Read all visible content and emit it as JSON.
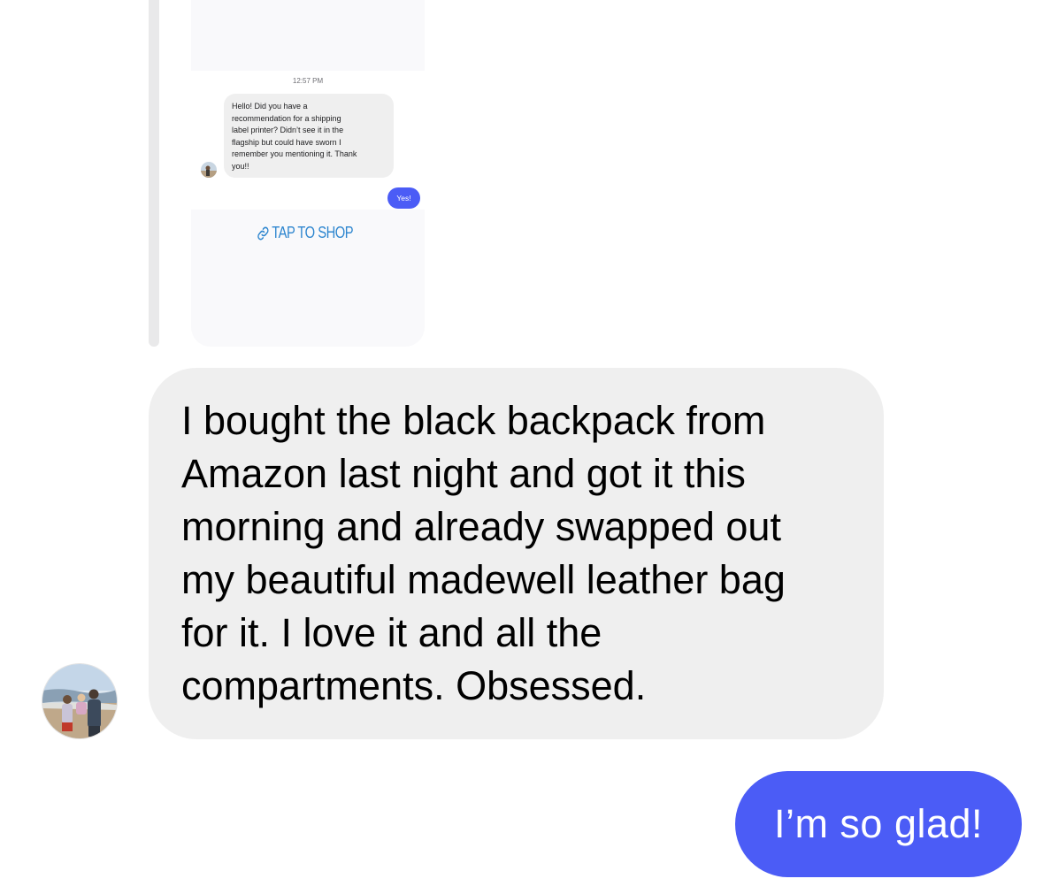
{
  "quoted_thread": {
    "timestamp": "12:57 PM",
    "received_message_lines": [
      "Hello! Did you have a",
      "recommendation for a shipping",
      "label printer? Didn’t see it in the",
      "flagship but could have sworn I",
      "remember you mentioning it. Thank",
      "you!!"
    ],
    "sent_message": "Yes!",
    "link_label": "TAP TO SHOP",
    "link_icon": "link-icon"
  },
  "conversation": {
    "received_message_lines": [
      "I bought the black backpack from",
      "Amazon last night and got it this",
      "morning and already swapped out",
      "my beautiful madewell leather bag",
      "for it. I love it and all the",
      "compartments. Obsessed."
    ],
    "sent_message": "I’m so glad!"
  },
  "colors": {
    "sent_bubble": "#4b5cf6",
    "received_bubble": "#efefef",
    "link": "#2e86cf",
    "timestamp": "#6f6f74"
  }
}
